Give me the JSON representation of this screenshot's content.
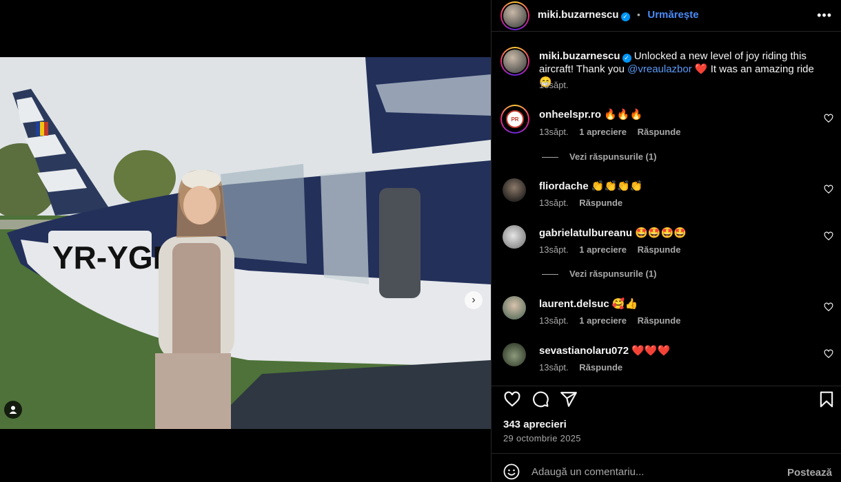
{
  "post": {
    "author": "miki.buzarnescu",
    "follow_label": "Urmărește",
    "separator": "•",
    "more_label": "•••",
    "caption_start": "Unlocked a new level of joy riding this aircraft! Thank you",
    "caption_mention": "@vreaulazbor",
    "caption_heart": "❤️",
    "caption_end": "It was an amazing ride 😁",
    "caption_time": "13săpt.",
    "registration": "YR-YGR",
    "next_label": "›"
  },
  "comments": [
    {
      "user": "onheelspr.ro",
      "text": "🔥🔥🔥",
      "time": "13săpt.",
      "likes": "1 apreciere",
      "reply": "Răspunde",
      "replies": "Vezi răspunsurile (1)",
      "avatar_color": "#ffffff"
    },
    {
      "user": "fliordache",
      "text": "👏👏👏👏",
      "time": "13săpt.",
      "likes": "",
      "reply": "Răspunde",
      "replies": "",
      "avatar_color": "#3a3530"
    },
    {
      "user": "gabrielatulbureanu",
      "text": "🤩🤩🤩🤩",
      "time": "13săpt.",
      "likes": "1 apreciere",
      "reply": "Răspunde",
      "replies": "Vezi răspunsurile (1)",
      "avatar_color": "#9a9a9a"
    },
    {
      "user": "laurent.delsuc",
      "text": "🥰👍",
      "time": "13săpt.",
      "likes": "1 apreciere",
      "reply": "Răspunde",
      "replies": "",
      "avatar_color": "#7d8a7a"
    },
    {
      "user": "sevastianolaru072",
      "text": "❤️❤️❤️",
      "time": "13săpt.",
      "likes": "",
      "reply": "Răspunde",
      "replies": "",
      "avatar_color": "#5a6a55"
    }
  ],
  "stats": {
    "likes": "343 aprecieri",
    "date": "29 octombrie 2025"
  },
  "composer": {
    "placeholder": "Adaugă un comentariu...",
    "post_label": "Postează"
  },
  "colors": {
    "accent": "#0095f6",
    "link": "#5a9bf8",
    "secondary_text": "#a8a8a8",
    "divider": "#262626"
  }
}
